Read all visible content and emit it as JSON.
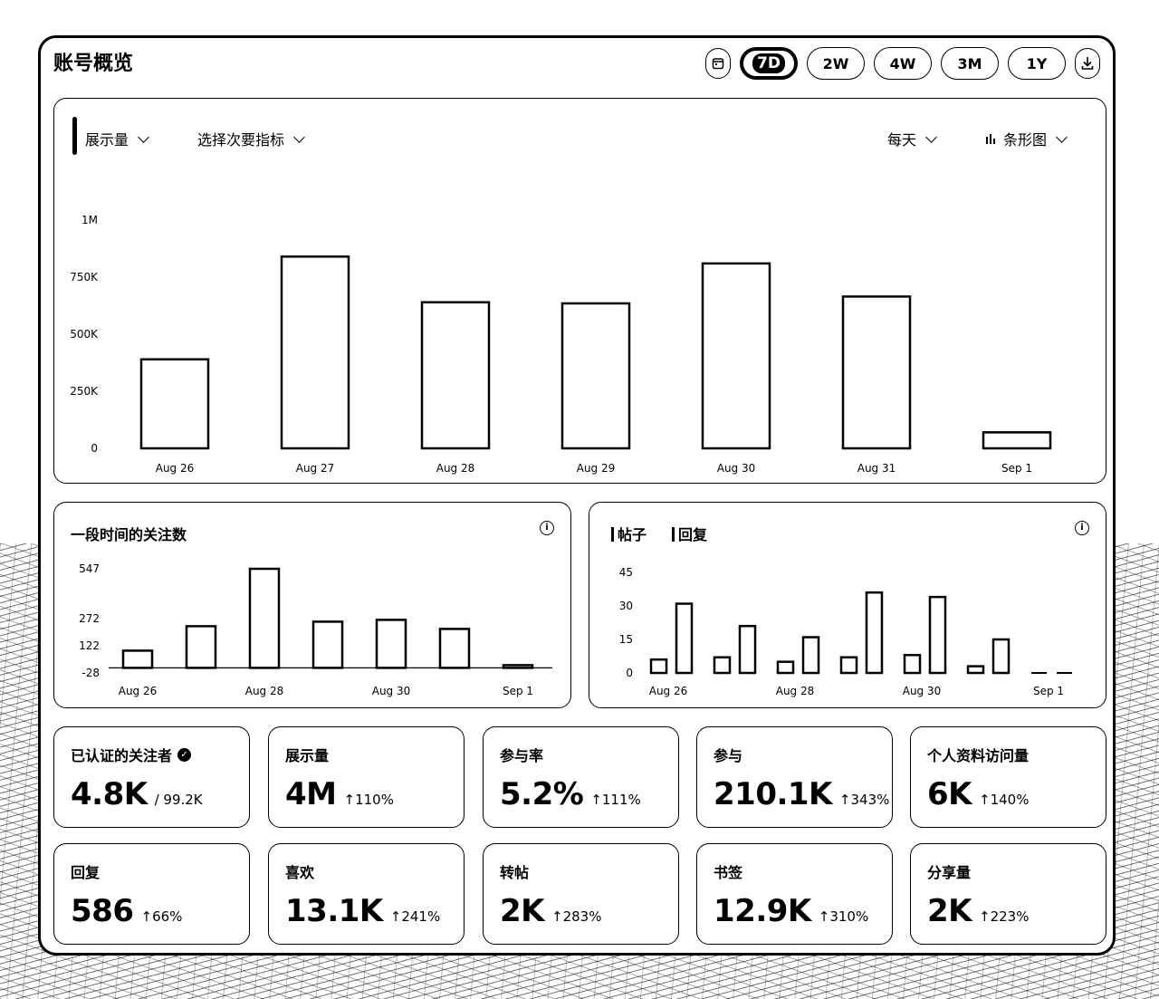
{
  "page": {
    "title": "账号概览"
  },
  "range": {
    "options": [
      "7D",
      "2W",
      "4W",
      "3M",
      "1Y"
    ],
    "selected": "7D"
  },
  "icons": [
    "calendar-icon",
    "download-icon",
    "chevron-down-icon",
    "bar-chart-icon",
    "info-icon",
    "verified-check-icon",
    "arrow-up-icon"
  ],
  "controls": {
    "primary_metric": "展示量",
    "secondary_metric": "选择次要指标",
    "interval": "每天",
    "chart_type": "条形图"
  },
  "chart_data": [
    {
      "type": "bar",
      "title": "",
      "categories": [
        "Aug 26",
        "Aug 27",
        "Aug 28",
        "Aug 29",
        "Aug 30",
        "Aug 31",
        "Sep 1"
      ],
      "values": [
        390000,
        840000,
        640000,
        635000,
        810000,
        665000,
        70000
      ],
      "yticks": [
        "1M",
        "750K",
        "500K",
        "250K",
        "0"
      ],
      "ylim": [
        0,
        1000000
      ],
      "grid": false
    },
    {
      "type": "bar",
      "title": "一段时间的关注数",
      "categories": [
        "Aug 26",
        "Aug 27",
        "Aug 28",
        "Aug 29",
        "Aug 30",
        "Aug 31",
        "Sep 1"
      ],
      "tick_labels": [
        "Aug 26",
        "Aug 28",
        "Aug 30",
        "Sep 1"
      ],
      "values": [
        95,
        230,
        547,
        255,
        265,
        215,
        15
      ],
      "yticks": [
        "547",
        "272",
        "122",
        "-28"
      ],
      "ylim": [
        -28,
        547
      ],
      "grid": false
    },
    {
      "type": "bar",
      "title": "",
      "categories": [
        "Aug 26",
        "Aug 27",
        "Aug 28",
        "Aug 29",
        "Aug 30",
        "Aug 31",
        "Sep 1"
      ],
      "tick_labels": [
        "Aug 26",
        "Aug 28",
        "Aug 30",
        "Sep 1"
      ],
      "series": [
        {
          "name": "帖子",
          "values": [
            6,
            7,
            5,
            7,
            8,
            3,
            0
          ]
        },
        {
          "name": "回复",
          "values": [
            31,
            21,
            16,
            36,
            34,
            15,
            0
          ]
        }
      ],
      "yticks": [
        "45",
        "30",
        "15",
        "0"
      ],
      "ylim": [
        0,
        45
      ],
      "grid": false
    }
  ],
  "followers_card": {
    "title": "一段时间的关注数"
  },
  "posts_card": {
    "legend_posts": "帖子",
    "legend_replies": "回复"
  },
  "stats": [
    {
      "label": "已认证的关注者",
      "value": "4.8K",
      "extra": "/ 99.2K",
      "verified": true
    },
    {
      "label": "展示量",
      "value": "4M",
      "delta": "110%"
    },
    {
      "label": "参与率",
      "value": "5.2%",
      "delta": "111%"
    },
    {
      "label": "参与",
      "value": "210.1K",
      "delta": "343%"
    },
    {
      "label": "个人资料访问量",
      "value": "6K",
      "delta": "140%"
    },
    {
      "label": "回复",
      "value": "586",
      "delta": "66%"
    },
    {
      "label": "喜欢",
      "value": "13.1K",
      "delta": "241%"
    },
    {
      "label": "转帖",
      "value": "2K",
      "delta": "283%"
    },
    {
      "label": "书签",
      "value": "12.9K",
      "delta": "310%"
    },
    {
      "label": "分享量",
      "value": "2K",
      "delta": "223%"
    }
  ],
  "arrow": "↑"
}
